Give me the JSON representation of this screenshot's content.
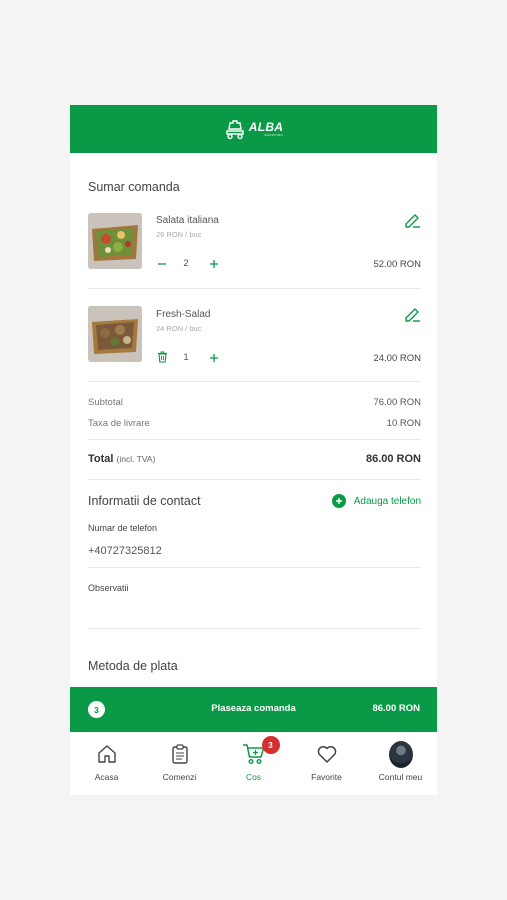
{
  "header": {
    "logo_text": "ALBA",
    "logo_sub": "SHOPPING"
  },
  "summary": {
    "title": "Sumar comanda",
    "items": [
      {
        "name": "Salata italiana",
        "unit_price": "26 RON / buc",
        "quantity": "2",
        "price": "52.00 RON",
        "image": "salad-italiana-photo"
      },
      {
        "name": "Fresh-Salad",
        "unit_price": "24 RON / buc",
        "quantity": "1",
        "price": "24.00 RON",
        "image": "fresh-salad-photo"
      }
    ],
    "subtotal_label": "Subtotal",
    "subtotal_value": "76.00 RON",
    "delivery_label": "Taxa de livrare",
    "delivery_value": "10 RON",
    "total_label": "Total",
    "total_note": "(incl. TVA)",
    "total_value": "86.00 RON"
  },
  "contact": {
    "title": "Informatii de contact",
    "add_phone_label": "Adauga telefon",
    "phone_label": "Numar de telefon",
    "phone_value": "+40727325812",
    "notes_label": "Observatii"
  },
  "payment": {
    "title": "Metoda de plata"
  },
  "order_bar": {
    "count": "3",
    "label": "Plaseaza comanda",
    "total": "86.00 RON"
  },
  "tabbar": {
    "tabs": [
      {
        "label": "Acasa",
        "icon": "home-icon"
      },
      {
        "label": "Comenzi",
        "icon": "clipboard-icon"
      },
      {
        "label": "Cos",
        "icon": "cart-icon",
        "active": true,
        "badge": "3"
      },
      {
        "label": "Favorite",
        "icon": "heart-icon"
      },
      {
        "label": "Contul meu",
        "icon": "avatar"
      }
    ]
  },
  "colors": {
    "brand_green": "#0a9a47",
    "badge_red": "#d32f2f"
  }
}
